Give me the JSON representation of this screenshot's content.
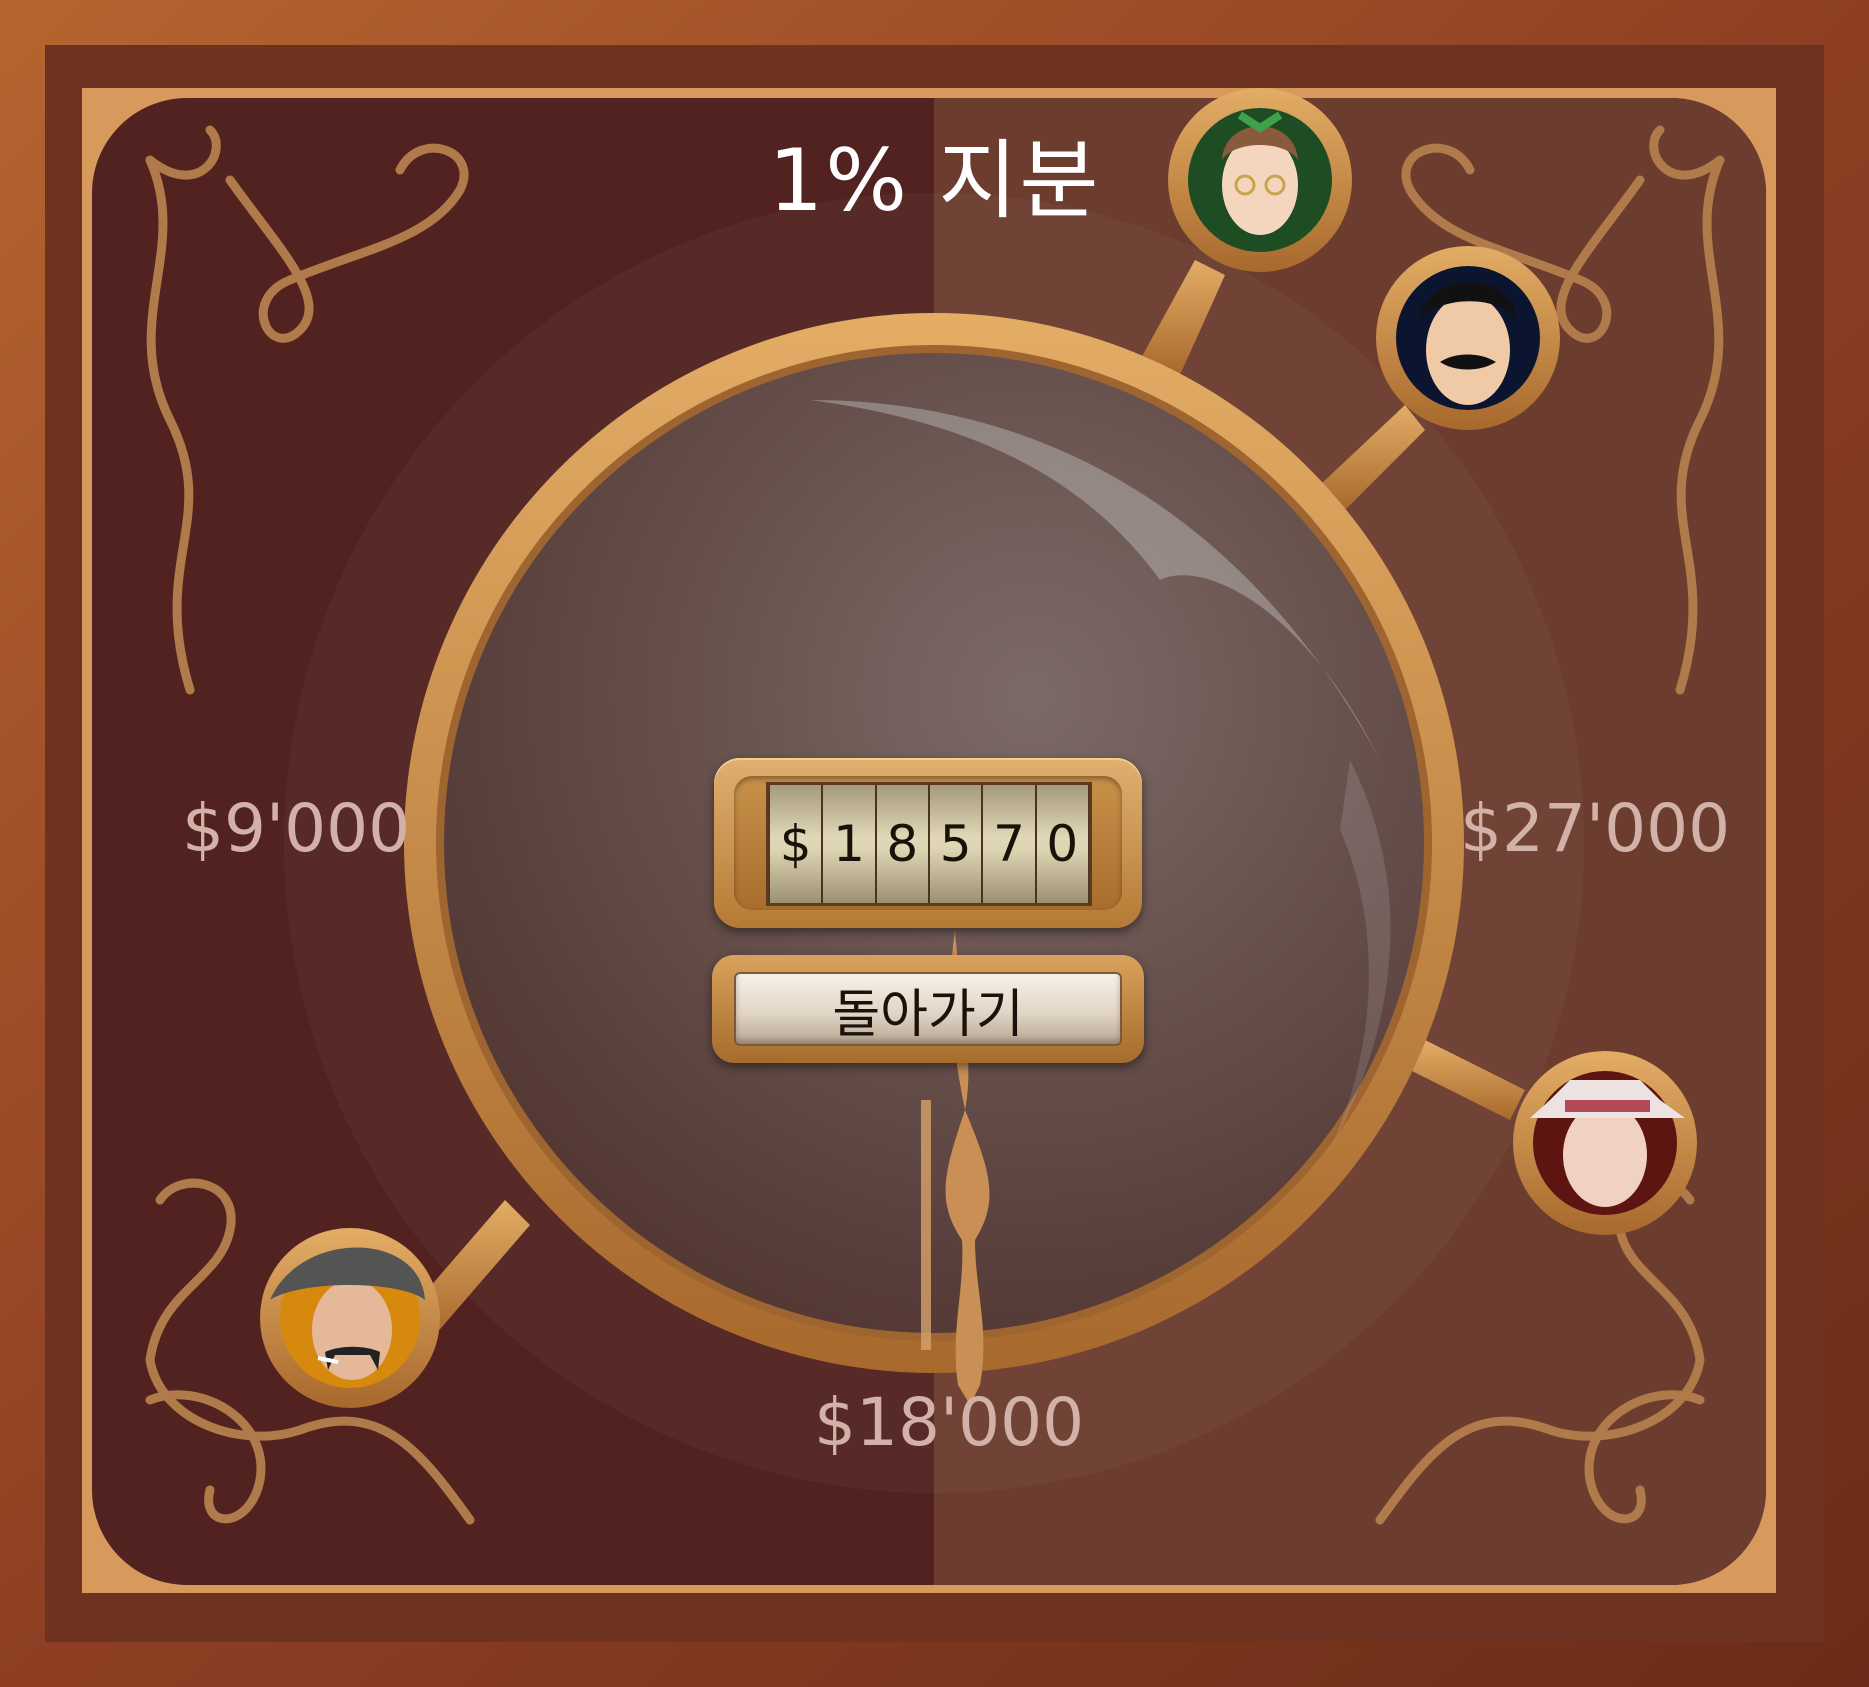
{
  "game": {
    "title": "1% 지분",
    "dial_labels": {
      "left": "$9'000",
      "right": "$27'000",
      "bottom": "$18'000"
    },
    "counter": {
      "digits": [
        "$",
        "1",
        "8",
        "5",
        "7",
        "0"
      ]
    },
    "back_button_label": "돌아가기",
    "players": [
      {
        "icon": "woman-glasses-green-bow-avatar"
      },
      {
        "icon": "mustached-man-dark-avatar"
      },
      {
        "icon": "old-man-white-hat-avatar"
      },
      {
        "icon": "cowboy-with-cigarette-avatar"
      }
    ],
    "colors": {
      "frame": "#a0522d",
      "board_left": "#512220",
      "board_right": "#6a3b2e",
      "gold": "#c9934f"
    }
  }
}
